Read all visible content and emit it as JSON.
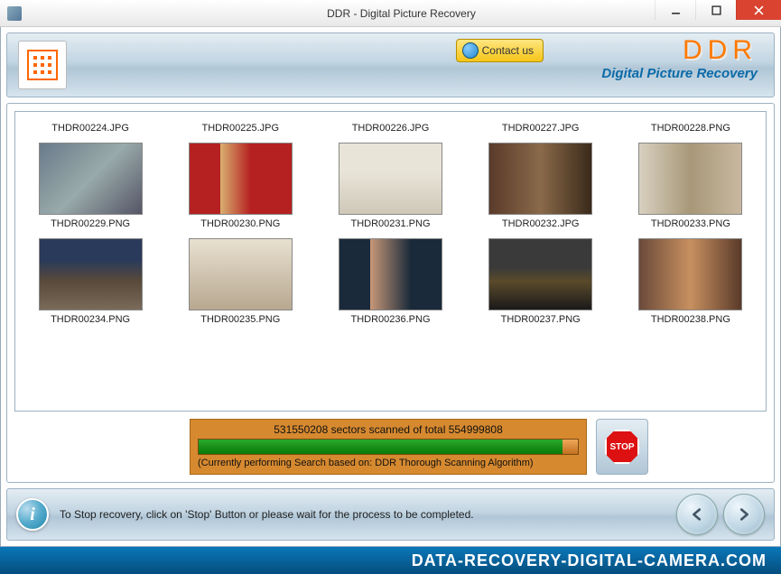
{
  "titlebar": {
    "title": "DDR - Digital Picture Recovery"
  },
  "header": {
    "contact_label": "Contact us",
    "brand": "DDR",
    "brand_sub": "Digital Picture Recovery"
  },
  "files": [
    {
      "name": "THDR00224.JPG",
      "thumb": "noimg"
    },
    {
      "name": "THDR00225.JPG",
      "thumb": "noimg"
    },
    {
      "name": "THDR00226.JPG",
      "thumb": "noimg"
    },
    {
      "name": "THDR00227.JPG",
      "thumb": "noimg"
    },
    {
      "name": "THDR00228.PNG",
      "thumb": "noimg"
    },
    {
      "name": "THDR00229.PNG",
      "thumb": "t1"
    },
    {
      "name": "THDR00230.PNG",
      "thumb": "t2"
    },
    {
      "name": "THDR00231.PNG",
      "thumb": "t3"
    },
    {
      "name": "THDR00232.JPG",
      "thumb": "t4"
    },
    {
      "name": "THDR00233.PNG",
      "thumb": "t5"
    },
    {
      "name": "THDR00234.PNG",
      "thumb": "t6"
    },
    {
      "name": "THDR00235.PNG",
      "thumb": "t7"
    },
    {
      "name": "THDR00236.PNG",
      "thumb": "t8"
    },
    {
      "name": "THDR00237.PNG",
      "thumb": "t9"
    },
    {
      "name": "THDR00238.PNG",
      "thumb": "t10"
    }
  ],
  "progress": {
    "scanned_text": "531550208 sectors scanned of total 554999808",
    "algo_text": "(Currently performing Search based on:  DDR Thorough Scanning Algorithm)",
    "stop_label": "STOP"
  },
  "footer": {
    "hint": "To Stop recovery, click on 'Stop' Button or please wait for the process to be completed."
  },
  "bottom": {
    "url": "DATA-RECOVERY-DIGITAL-CAMERA.COM"
  }
}
